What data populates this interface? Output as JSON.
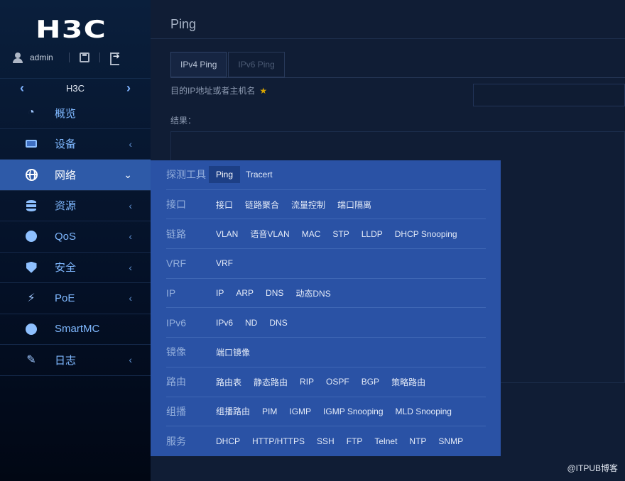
{
  "brand": {
    "logo": "H3C"
  },
  "user": {
    "name": "admin"
  },
  "device": {
    "name": "H3C"
  },
  "sidebar": {
    "items": [
      {
        "label": "概览",
        "icon": "dashboard-icon",
        "has_arrow": false
      },
      {
        "label": "设备",
        "icon": "device-icon",
        "has_arrow": true
      },
      {
        "label": "网络",
        "icon": "globe-icon",
        "has_arrow": true,
        "active": true
      },
      {
        "label": "资源",
        "icon": "database-icon",
        "has_arrow": true
      },
      {
        "label": "QoS",
        "icon": "qos-icon",
        "has_arrow": true
      },
      {
        "label": "安全",
        "icon": "shield-icon",
        "has_arrow": true
      },
      {
        "label": "PoE",
        "icon": "poe-icon",
        "has_arrow": true
      },
      {
        "label": "SmartMC",
        "icon": "smartmc-icon",
        "has_arrow": false
      },
      {
        "label": "日志",
        "icon": "log-icon",
        "has_arrow": true
      }
    ],
    "arrow_right": "‹",
    "arrow_down": "⌄"
  },
  "main": {
    "title": "Ping",
    "tabs": [
      {
        "label": "IPv4 Ping",
        "active": true
      },
      {
        "label": "IPv6 Ping",
        "active": false
      }
    ],
    "field_label": "目的IP地址或者主机名",
    "required_mark": "★",
    "result_label": "结果："
  },
  "flyout": {
    "rows": [
      {
        "category": "探测工具",
        "items": [
          "Ping",
          "Tracert"
        ],
        "selected": "Ping"
      },
      {
        "category": "接口",
        "items": [
          "接口",
          "链路聚合",
          "流量控制",
          "端口隔离"
        ]
      },
      {
        "category": "链路",
        "items": [
          "VLAN",
          "语音VLAN",
          "MAC",
          "STP",
          "LLDP",
          "DHCP Snooping"
        ]
      },
      {
        "category": "VRF",
        "items": [
          "VRF"
        ]
      },
      {
        "category": "IP",
        "items": [
          "IP",
          "ARP",
          "DNS",
          "动态DNS"
        ]
      },
      {
        "category": "IPv6",
        "items": [
          "IPv6",
          "ND",
          "DNS"
        ]
      },
      {
        "category": "镜像",
        "items": [
          "端口镜像"
        ]
      },
      {
        "category": "路由",
        "items": [
          "路由表",
          "静态路由",
          "RIP",
          "OSPF",
          "BGP",
          "策略路由"
        ]
      },
      {
        "category": "组播",
        "items": [
          "组播路由",
          "PIM",
          "IGMP",
          "IGMP Snooping",
          "MLD Snooping"
        ]
      },
      {
        "category": "服务",
        "items": [
          "DHCP",
          "HTTP/HTTPS",
          "SSH",
          "FTP",
          "Telnet",
          "NTP",
          "SNMP"
        ]
      }
    ]
  },
  "watermark": "@ITPUB博客",
  "colors": {
    "accent": "#2e5aa8",
    "flyout_bg": "#2a52a5",
    "sidebar_bg": "#041026",
    "link": "#7fb8ff"
  }
}
